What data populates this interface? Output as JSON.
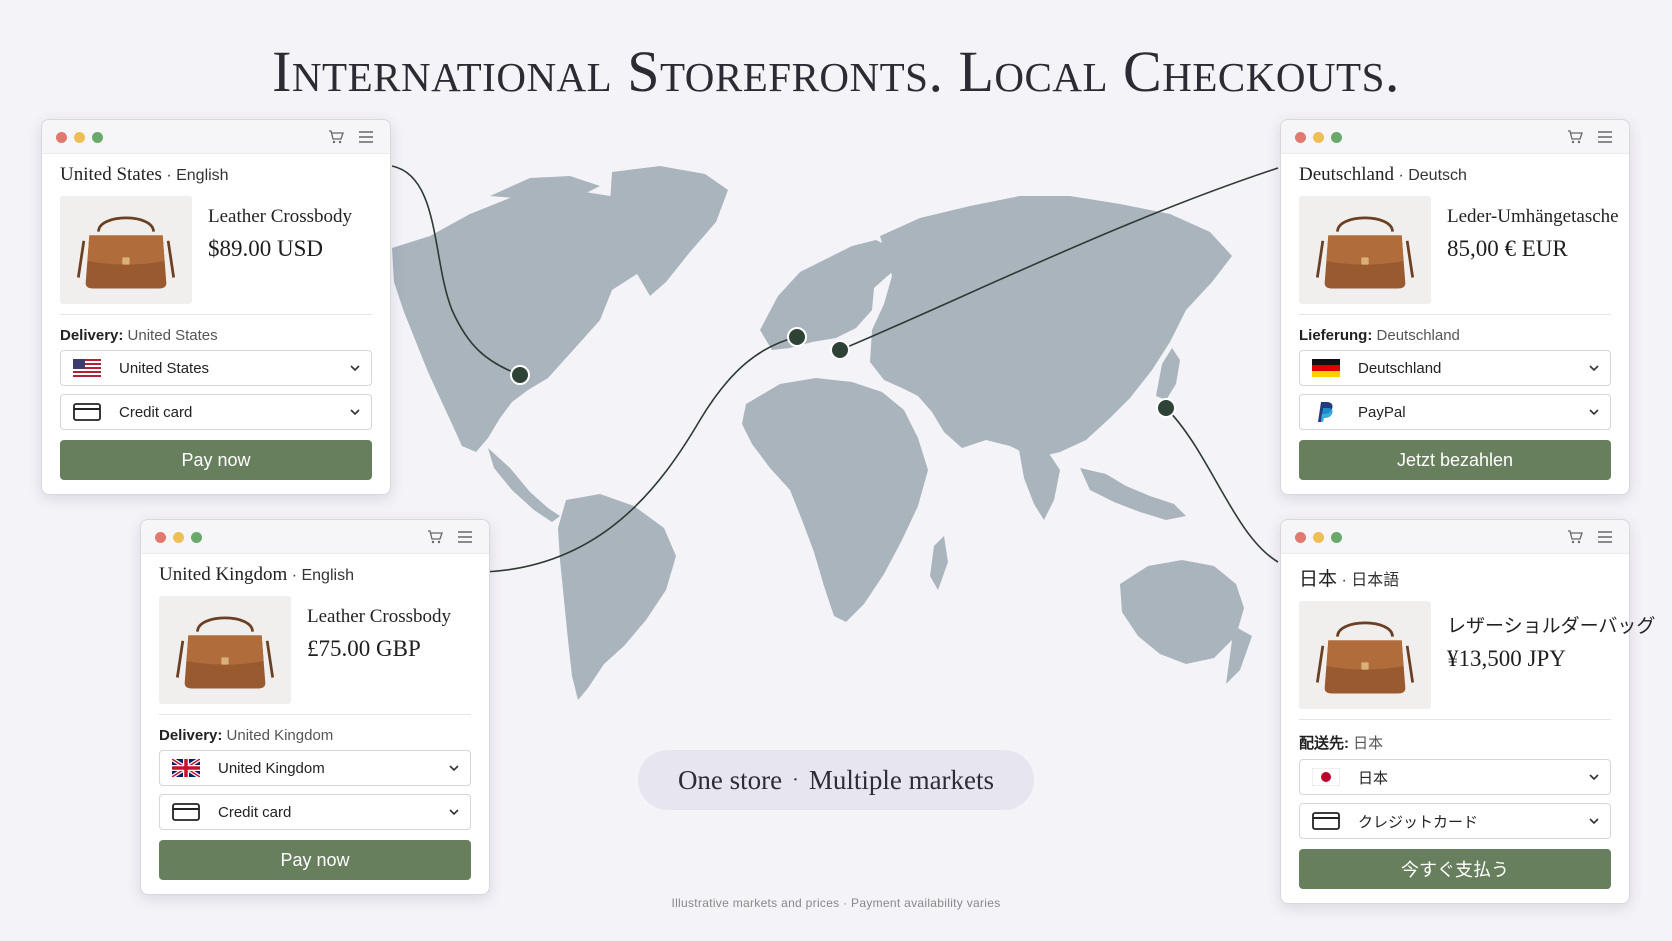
{
  "headline": "International Storefronts. Local Checkouts.",
  "tagline": {
    "left": "One store",
    "sep": "·",
    "right": "Multiple markets"
  },
  "footnote": "Illustrative markets and prices · Payment availability varies",
  "colors": {
    "pay_button": "#687f5d",
    "map_land": "#a9b4bd",
    "connector": "#2d3a34"
  },
  "storefronts": {
    "us": {
      "market": "United States",
      "sep": "·",
      "language": "English",
      "product_name": "Leather Crossbody",
      "price": "$89.00 USD",
      "delivery_label": "Delivery:",
      "delivery_value": "United States",
      "country_select": "United States",
      "country_icon": "us-flag-icon",
      "payment_select": "Credit card",
      "payment_icon": "credit-card-icon",
      "pay_label": "Pay now"
    },
    "de": {
      "market": "Deutschland",
      "sep": "·",
      "language": "Deutsch",
      "product_name": "Leder-Umhängetasche",
      "price": "85,00 € EUR",
      "delivery_label": "Lieferung:",
      "delivery_value": "Deutschland",
      "country_select": "Deutschland",
      "country_icon": "de-flag-icon",
      "payment_select": "PayPal",
      "payment_icon": "paypal-icon",
      "pay_label": "Jetzt bezahlen"
    },
    "uk": {
      "market": "United Kingdom",
      "sep": "·",
      "language": "English",
      "product_name": "Leather Crossbody",
      "price": "£75.00 GBP",
      "delivery_label": "Delivery:",
      "delivery_value": "United Kingdom",
      "country_select": "United Kingdom",
      "country_icon": "uk-flag-icon",
      "payment_select": "Credit card",
      "payment_icon": "credit-card-icon",
      "pay_label": "Pay now"
    },
    "jp": {
      "market": "日本",
      "sep": "·",
      "language": "日本語",
      "product_name": "レザーショルダーバッグ",
      "price": "¥13,500 JPY",
      "delivery_label": "配送先:",
      "delivery_value": "日本",
      "country_select": "日本",
      "country_icon": "jp-flag-icon",
      "payment_select": "クレジットカード",
      "payment_icon": "credit-card-icon",
      "pay_label": "今すぐ支払う"
    }
  }
}
